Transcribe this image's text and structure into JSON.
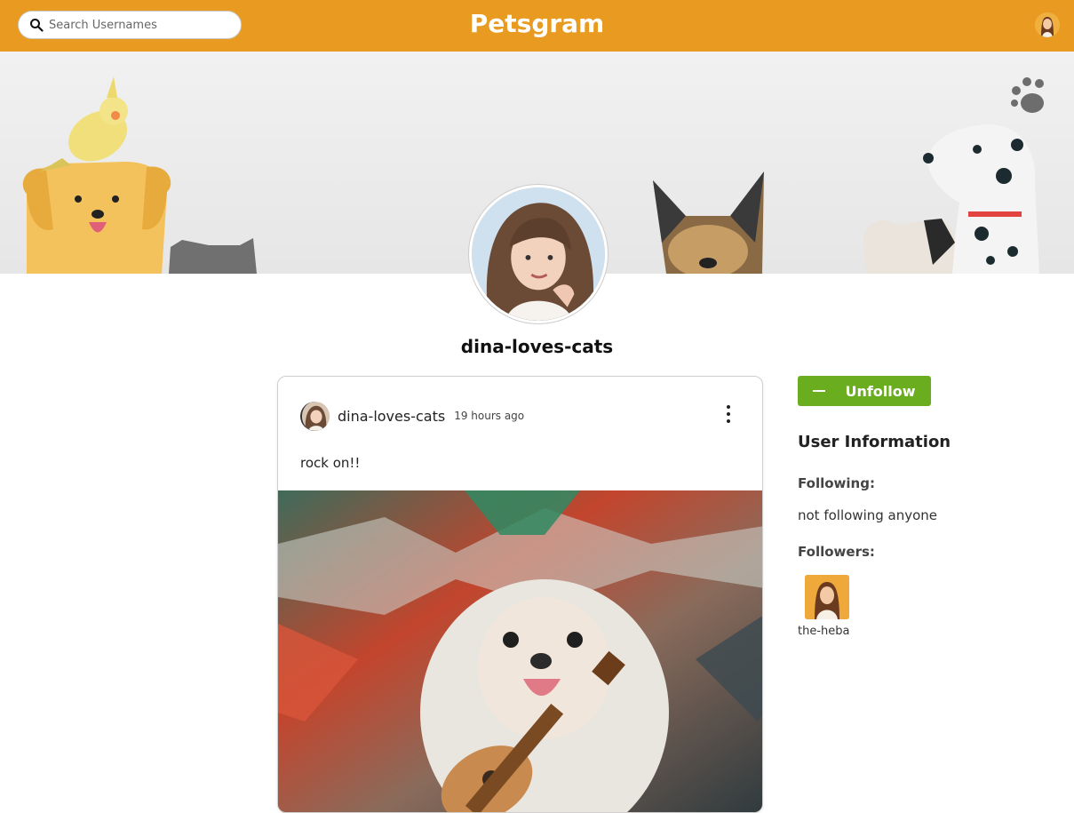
{
  "header": {
    "brand": "Petsgram",
    "search_placeholder": "Search Usernames",
    "brand_color": "#e89a21"
  },
  "profile": {
    "username": "dina-loves-cats"
  },
  "post": {
    "username": "dina-loves-cats",
    "time": "19 hours ago",
    "caption": "rock on!!"
  },
  "sidebar": {
    "unfollow_label": "Unfollow",
    "info_title": "User Information",
    "following_label": "Following:",
    "following_value": "not following anyone",
    "followers_label": "Followers:",
    "followers": [
      {
        "name": "the-heba"
      }
    ],
    "button_color": "#6aae1f"
  }
}
